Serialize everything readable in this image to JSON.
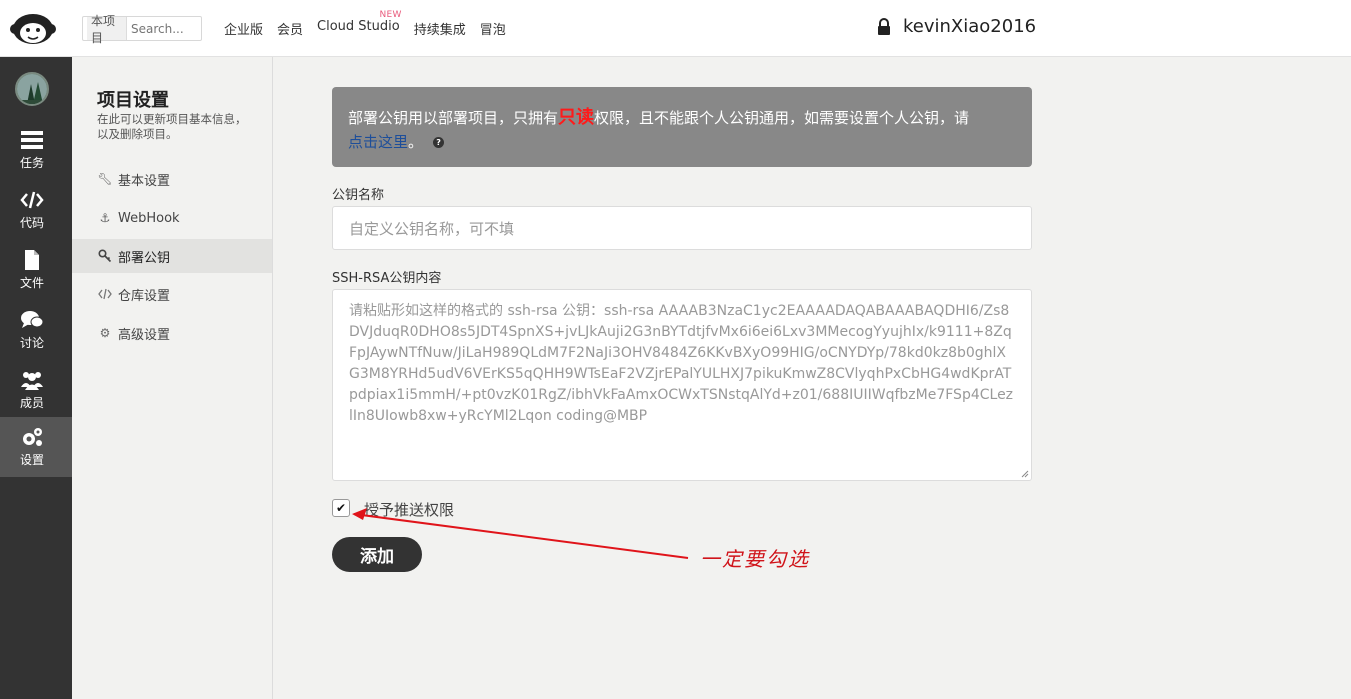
{
  "header": {
    "scope_label": "本项目",
    "search_placeholder": "Search...",
    "nav": [
      {
        "label": "企业版"
      },
      {
        "label": "会员"
      },
      {
        "label": "Cloud Studio",
        "badge": "NEW"
      },
      {
        "label": "持续集成"
      },
      {
        "label": "冒泡"
      }
    ],
    "username": "kevinXiao2016"
  },
  "sidebar": {
    "items": [
      {
        "label": "任务",
        "icon": "tasks-icon"
      },
      {
        "label": "代码",
        "icon": "code-icon"
      },
      {
        "label": "文件",
        "icon": "file-icon"
      },
      {
        "label": "讨论",
        "icon": "discussion-icon"
      },
      {
        "label": "成员",
        "icon": "members-icon"
      },
      {
        "label": "设置",
        "icon": "settings-icon",
        "active": true
      }
    ]
  },
  "settings_menu": {
    "title": "项目设置",
    "description": "在此可以更新项目基本信息，以及删除项目。",
    "items": [
      {
        "label": "基本设置",
        "icon": "wrench-icon"
      },
      {
        "label": "WebHook",
        "icon": "anchor-icon"
      },
      {
        "label": "部署公钥",
        "icon": "key-icon",
        "active": true
      },
      {
        "label": "仓库设置",
        "icon": "code-icon"
      },
      {
        "label": "高级设置",
        "icon": "gears-icon"
      }
    ]
  },
  "notice": {
    "text_before": "部署公钥用以部署项目，只拥有",
    "emphasis": "只读",
    "text_after": "权限，且不能跟个人公钥通用，如需要设置个人公钥，请",
    "link": "点击这里",
    "end": "。"
  },
  "form": {
    "name_label": "公钥名称",
    "name_placeholder": "自定义公钥名称，可不填",
    "content_label": "SSH-RSA公钥内容",
    "content_placeholder": "请粘贴形如这样的格式的 ssh-rsa 公钥：ssh-rsa AAAAB3NzaC1yc2EAAAADAQABAAABAQDHI6/Zs8DVJduqR0DHO8s5JDT4SpnXS+jvLJkAuji2G3nBYTdtjfvMx6i6ei6Lxv3MMecogYyujhIx/k9111+8ZqFpJAywNTfNuw/JiLaH989QLdM7F2NaJi3OHV8484Z6KKvBXyO99HIG/oCNYDYp/78kd0kz8b0ghlXG3M8YRHd5udV6VErKS5qQHH9WTsEaF2VZjrEPalYULHXJ7pikuKmwZ8CVlyqhPxCbHG4wdKprATpdpiax1i5mmH/+pt0vzK01RgZ/ibhVkFaAmxOCWxTSNstqAlYd+z01/688IUIIWqfbzMe7FSp4CLezlIn8UIowb8xw+yRcYMl2Lqon coding@MBP",
    "grant_push_label": "授予推送权限",
    "grant_push_checked": true,
    "submit_label": "添加"
  },
  "annotation": {
    "text": "一定要勾选",
    "color": "#d0141a"
  }
}
